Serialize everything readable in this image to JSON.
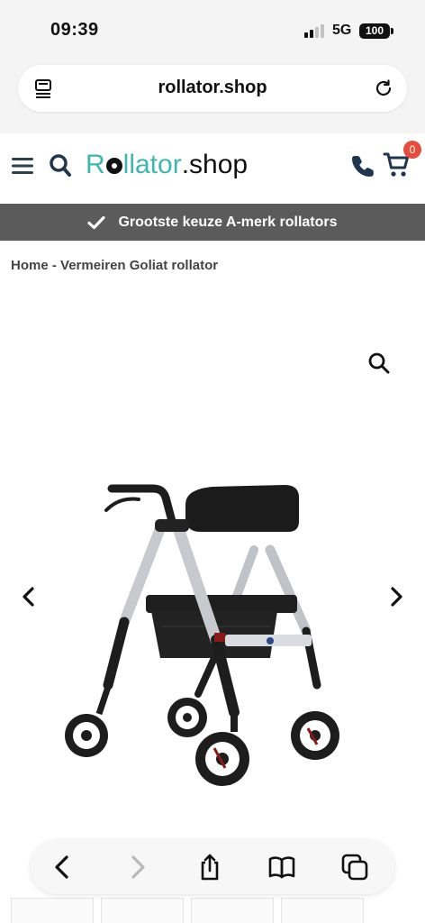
{
  "status_bar": {
    "time": "09:39",
    "network": "5G",
    "battery": "100"
  },
  "browser": {
    "url": "rollator.shop",
    "reader_icon": "reader-icon",
    "reload_icon": "reload-icon"
  },
  "header": {
    "logo_r": "R",
    "logo_rest": "llator",
    "logo_shop": ".shop",
    "cart_count": "0",
    "brand_color": "#3fb6b0",
    "badge_color": "#e74c3c"
  },
  "promo": {
    "text": "Grootste keuze A-merk rollators"
  },
  "breadcrumb": {
    "home": "Home",
    "separator": " - ",
    "current": "Vermeiren Goliat rollator"
  },
  "gallery": {
    "image_alt": "Vermeiren Goliat rollator"
  }
}
